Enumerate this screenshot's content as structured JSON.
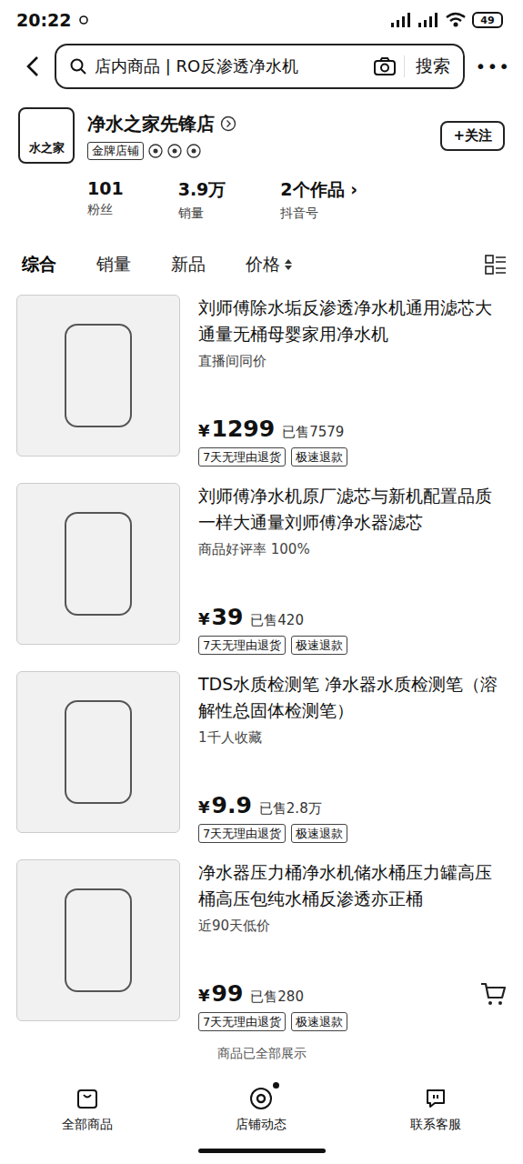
{
  "status_bar": {
    "time": "20:22",
    "battery": "49"
  },
  "search": {
    "query": "店内商品 | RO反渗透净水机",
    "button": "搜索",
    "more": "•••"
  },
  "shop": {
    "name": "净水之家先锋店",
    "logo_text": "水之家",
    "badge": "金牌店铺",
    "follow": "+关注",
    "stats": [
      {
        "value": "101",
        "label": "粉丝"
      },
      {
        "value": "3.9万",
        "label": "销量"
      },
      {
        "value": "2个作品 ›",
        "label": "抖音号"
      }
    ]
  },
  "sort_tabs": [
    {
      "label": "综合",
      "selected": true,
      "sortable": false
    },
    {
      "label": "销量",
      "selected": false,
      "sortable": false
    },
    {
      "label": "新品",
      "selected": false,
      "sortable": false
    },
    {
      "label": "价格",
      "selected": false,
      "sortable": true
    }
  ],
  "products": [
    {
      "title": "刘师傅除水垢反渗透净水机通用滤芯大通量无桶母婴家用净水机",
      "subtitle": "直播间同价",
      "currency": "¥",
      "price": "1299",
      "sold": "已售7579",
      "tags": [
        "7天无理由退货",
        "极速退款"
      ],
      "cart": false
    },
    {
      "title": "刘师傅净水机原厂滤芯与新机配置品质一样大通量刘师傅净水器滤芯",
      "subtitle": "商品好评率 100%",
      "currency": "¥",
      "price": "39",
      "sold": "已售420",
      "tags": [
        "7天无理由退货",
        "极速退款"
      ],
      "cart": false
    },
    {
      "title": "TDS水质检测笔 净水器水质检测笔（溶解性总固体检测笔）",
      "subtitle": "1千人收藏",
      "currency": "¥",
      "price": "9.9",
      "sold": "已售2.8万",
      "tags": [
        "7天无理由退货",
        "极速退款"
      ],
      "cart": false
    },
    {
      "title": "净水器压力桶净水机储水桶压力罐高压桶高压包纯水桶反渗透亦正桶",
      "subtitle": "近90天低价",
      "currency": "¥",
      "price": "99",
      "sold": "已售280",
      "tags": [
        "7天无理由退货",
        "极速退款"
      ],
      "cart": true
    }
  ],
  "footer_note": "商品已全部展示",
  "bottom_nav": [
    {
      "label": "全部商品",
      "kind": "bag",
      "dot": false
    },
    {
      "label": "店铺动态",
      "kind": "feed",
      "dot": true
    },
    {
      "label": "联系客服",
      "kind": "chat",
      "dot": false
    }
  ]
}
